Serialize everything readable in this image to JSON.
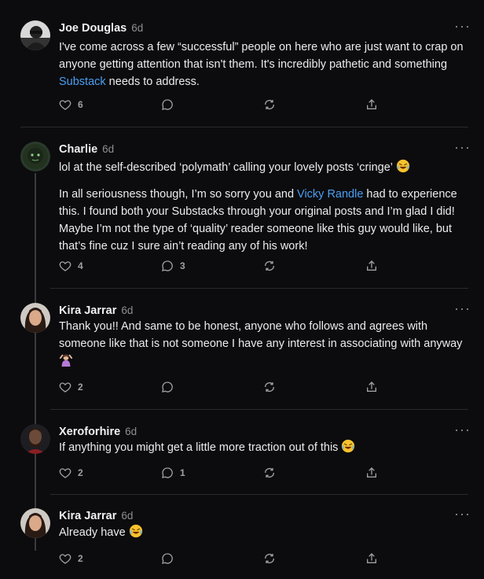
{
  "comments": [
    {
      "author": "Joe Douglas",
      "time": "6d",
      "body": [
        {
          "before": "I've come across a few “successful” people on here who are just want to crap on anyone getting attention that isn't them. It's incredibly pathetic and something ",
          "link": "Substack",
          "after": " needs to address."
        }
      ],
      "likes": "6",
      "replies": ""
    },
    {
      "author": "Charlie",
      "time": "6d",
      "body": [
        {
          "before": "lol at the self-described ‘polymath’ calling your lovely posts ‘cringe’"
        },
        {
          "before": "In all seriousness though, I’m so sorry you and ",
          "link": "Vicky Randle",
          "after": " had to experience this. I found both your Substacks through your original posts and I’m glad I did! Maybe I’m not the type of ‘quality’ reader someone like this guy would like, but that’s fine cuz I sure ain’t reading any of his work!"
        }
      ],
      "likes": "4",
      "replies": "3"
    },
    {
      "author": "Kira Jarrar",
      "time": "6d",
      "body": [
        {
          "before": "Thank you!! And same to be honest, anyone who follows and agrees with someone like that is not someone I have any interest in associating with anyway"
        }
      ],
      "likes": "2",
      "replies": ""
    },
    {
      "author": "Xeroforhire",
      "time": "6d",
      "body": [
        {
          "before": "If anything you might get a little more traction out of this"
        }
      ],
      "likes": "2",
      "replies": "1"
    },
    {
      "author": "Kira Jarrar",
      "time": "6d",
      "body": [
        {
          "before": "Already have"
        }
      ],
      "likes": "2",
      "replies": ""
    }
  ],
  "icons": {
    "like": "heart-icon",
    "reply": "speech-bubble-icon",
    "restack": "restack-icon",
    "share": "share-icon",
    "more": "more-dots-icon"
  },
  "more_glyph": "···"
}
